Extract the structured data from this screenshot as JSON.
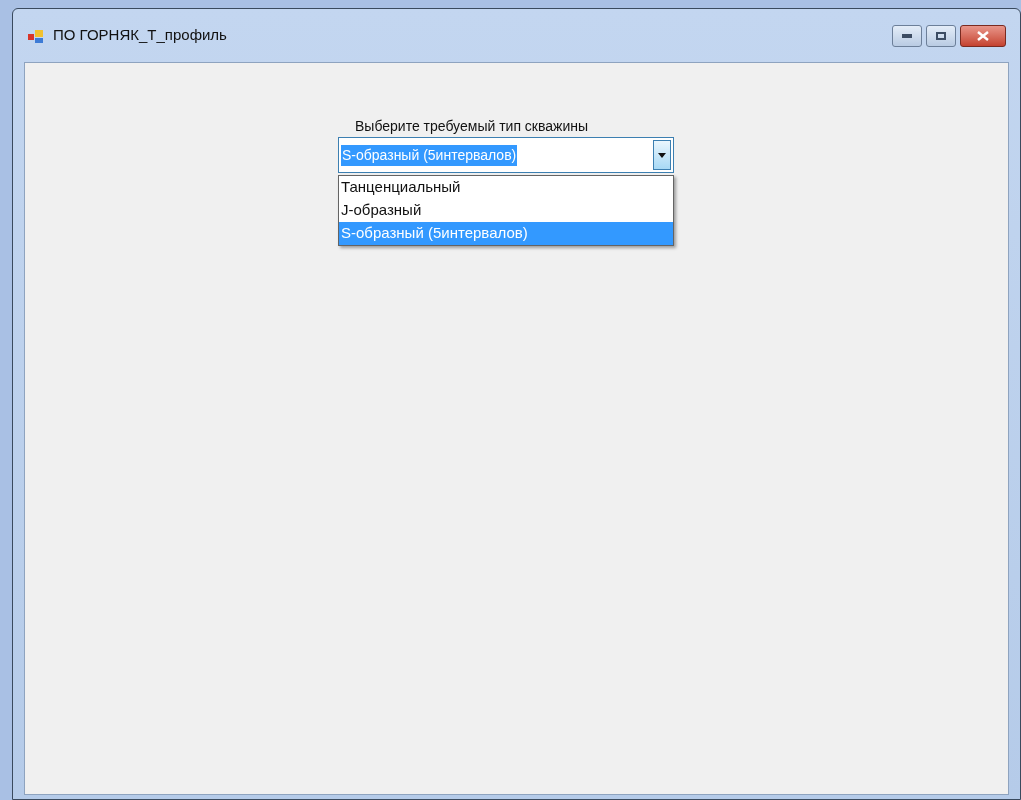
{
  "window": {
    "title": "ПО ГОРНЯК_Т_профиль"
  },
  "prompt": "Выберите требуемый тип скважины",
  "combo": {
    "value": "S-образный (5интервалов)",
    "expanded": true
  },
  "options": [
    {
      "label": "Танценциальный",
      "selected": false
    },
    {
      "label": "J-образный",
      "selected": false
    },
    {
      "label": "S-образный (5интервалов)",
      "selected": true
    }
  ]
}
